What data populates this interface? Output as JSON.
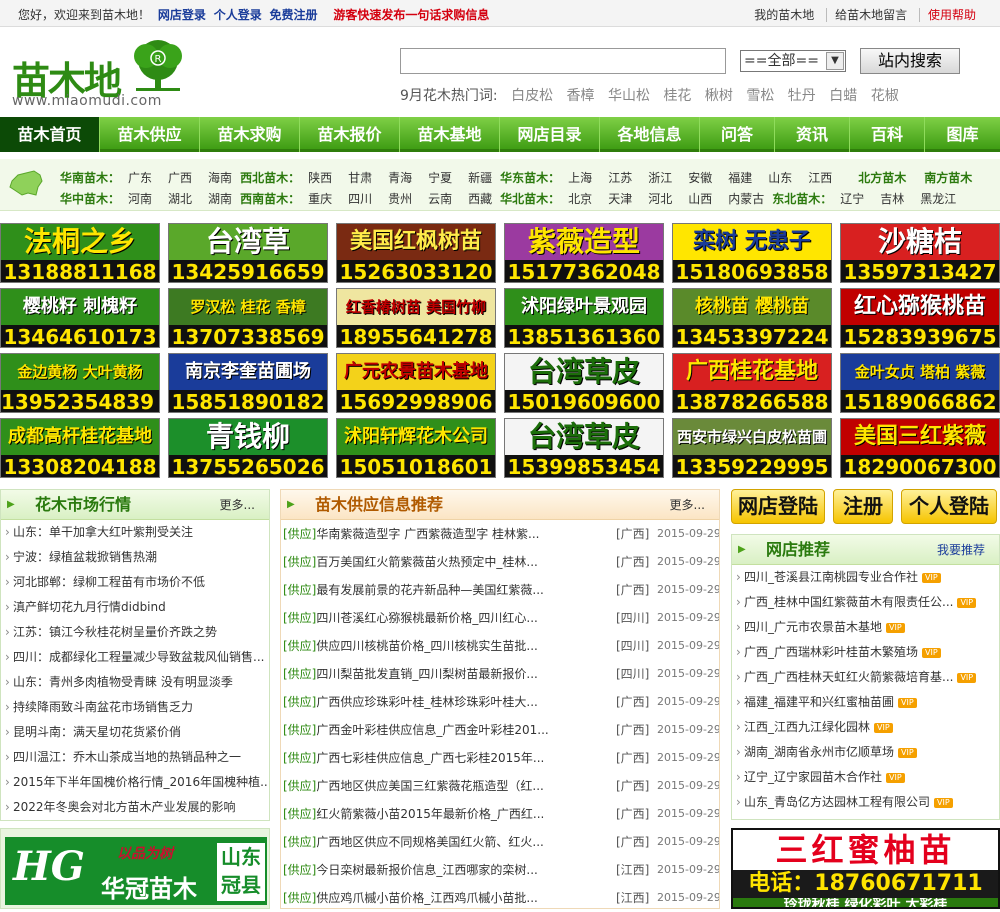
{
  "topbar": {
    "welcome": "您好，欢迎来到苗木地！",
    "shop_login": "网店登录",
    "personal_login": "个人登录",
    "register": "免费注册",
    "guest_post": "游客快速发布一句话求购信息",
    "my_account": "我的苗木地",
    "message": "给苗木地留言",
    "help": "使用帮助"
  },
  "logo": {
    "name": "苗木地",
    "url": "www.miaomudi.com"
  },
  "search": {
    "button": "站内搜索",
    "select": "==全部=="
  },
  "hot": {
    "label": "9月花木热门词:",
    "words": [
      "白皮松",
      "香樟",
      "华山松",
      "桂花",
      "楸树",
      "雪松",
      "牡丹",
      "白蜡",
      "花椒"
    ]
  },
  "nav": [
    "苗木首页",
    "苗木供应",
    "苗木求购",
    "苗木报价",
    "苗木基地",
    "网店目录",
    "各地信息",
    "问答",
    "资讯",
    "百科",
    "图库"
  ],
  "regions": {
    "row1": [
      {
        "name": "华南苗木：",
        "places": [
          "广东",
          "广西",
          "海南"
        ]
      },
      {
        "name": "西北苗木：",
        "places": [
          "陕西",
          "甘肃",
          "青海",
          "宁夏",
          "新疆"
        ]
      },
      {
        "name": "华东苗木：",
        "places": [
          "上海",
          "江苏",
          "浙江",
          "安徽",
          "福建",
          "山东",
          "江西"
        ]
      },
      {
        "name": "北方苗木",
        "places": []
      },
      {
        "name": "南方苗木",
        "places": []
      }
    ],
    "row2": [
      {
        "name": "华中苗木：",
        "places": [
          "河南",
          "湖北",
          "湖南"
        ]
      },
      {
        "name": "西南苗木：",
        "places": [
          "重庆",
          "四川",
          "贵州",
          "云南",
          "西藏"
        ]
      },
      {
        "name": "华北苗木：",
        "places": [
          "北京",
          "天津",
          "河北",
          "山西",
          "内蒙古"
        ]
      },
      {
        "name": "东北苗木：",
        "places": [
          "辽宁",
          "吉林",
          "黑龙江"
        ]
      }
    ]
  },
  "ads": [
    {
      "t1": "法桐之乡",
      "t2": "13188811168",
      "bg": "#2f8f1a",
      "fg": "#ffe600"
    },
    {
      "t1": "台湾草",
      "t2": "13425916659",
      "bg": "#5aa82a",
      "fg": "#ffffff"
    },
    {
      "t1": "美国红枫树苗",
      "t2": "15263033120",
      "bg": "#7a2a12",
      "fg": "#ffec4a"
    },
    {
      "t1": "紫薇造型",
      "t2": "15177362048",
      "bg": "#9b3aa0",
      "fg": "#ffe600"
    },
    {
      "t1": "栾树 无患子",
      "t2": "15180693858",
      "bg": "#ffe600",
      "fg": "#1a3c9a"
    },
    {
      "t1": "沙糖桔",
      "t2": "13597313427",
      "bg": "#d82020",
      "fg": "#ffffff"
    },
    {
      "t1": "樱桃籽 刺槐籽",
      "t2": "13464610173",
      "bg": "#2f8f1a",
      "fg": "#ffffff"
    },
    {
      "t1": "罗汉松 桂花 香樟",
      "t2": "13707338569",
      "bg": "#3d7a22",
      "fg": "#ffe600"
    },
    {
      "t1": "红香椿树苗 美国竹柳",
      "t2": "18955641278",
      "bg": "#efe6a0",
      "fg": "#c00000"
    },
    {
      "t1": "沭阳绿叶景观园",
      "t2": "13851361360",
      "bg": "#2f8f1a",
      "fg": "#ffffff"
    },
    {
      "t1": "核桃苗 樱桃苗",
      "t2": "13453397224",
      "bg": "#5a8a2a",
      "fg": "#ffe600"
    },
    {
      "t1": "红心猕猴桃苗",
      "t2": "15283939675",
      "bg": "#c00000",
      "fg": "#ffffff"
    },
    {
      "t1": "金边黄杨 大叶黄杨",
      "t2": "13952354839 朱",
      "bg": "#2f8f1a",
      "fg": "#ffe600"
    },
    {
      "t1": "南京李奎苗圃场",
      "t2": "15851890182",
      "bg": "#1a3c9a",
      "fg": "#ffffff"
    },
    {
      "t1": "广元农景苗木基地",
      "t2": "15692998906",
      "bg": "#f3d21a",
      "fg": "#c00000"
    },
    {
      "t1": "台湾草皮",
      "t2": "15019609600",
      "bg": "#f4f4f4",
      "fg": "#1c6e0a"
    },
    {
      "t1": "广西桂花基地",
      "t2": "13878266588",
      "bg": "#d82020",
      "fg": "#ffe600"
    },
    {
      "t1": "金叶女贞 塔柏 紫薇",
      "t2": "15189066862",
      "bg": "#1a3c9a",
      "fg": "#ffe600"
    },
    {
      "t1": "成都高杆桂花基地",
      "t2": "13308204188",
      "bg": "#2f8f1a",
      "fg": "#ffe600"
    },
    {
      "t1": "青钱柳",
      "t2": "13755265026",
      "bg": "#1c8f2a",
      "fg": "#ffffff"
    },
    {
      "t1": "沭阳轩辉花木公司",
      "t2": "15051018601",
      "bg": "#2f8f1a",
      "fg": "#ffe600"
    },
    {
      "t1": "台湾草皮",
      "t2": "15399853454",
      "bg": "#f4f4f4",
      "fg": "#1c6e0a"
    },
    {
      "t1": "西安市绿兴白皮松苗圃",
      "t2": "13359229995",
      "bg": "#6a8a3a",
      "fg": "#ffffff"
    },
    {
      "t1": "美国三红紫薇",
      "t2": "18290067300",
      "bg": "#c00000",
      "fg": "#ffe600"
    }
  ],
  "market": {
    "title": "花木市场行情",
    "more": "更多...",
    "items": [
      "山东：单干加拿大红叶紫荆受关注",
      "宁波：绿植盆栽掀销售热潮",
      "河北邯郸：绿柳工程苗有市场价不低",
      "滇产鲜切花九月行情didbind",
      "江苏：镇江今秋桂花树呈量价齐跌之势",
      "四川：成都绿化工程量减少导致盆栽风仙销售...",
      "山东：青州多肉植物受青睐 没有明显淡季",
      "持续降雨致斗南盆花市场销售乏力",
      "昆明斗南：满天星切花货紧价俏",
      "四川温江：乔木山茶成当地的热销品种之一",
      "2015年下半年国槐价格行情_2016年国槐种植...",
      "2022年冬奥会对北方苗木产业发展的影响"
    ]
  },
  "supply": {
    "title": "苗木供应信息推荐",
    "more": "更多...",
    "tag": "[供应]",
    "items": [
      {
        "t": "华南紫薇造型字 广西紫薇造型字 桂林紫...",
        "r": "[广西]",
        "d": "2015-09-29"
      },
      {
        "t": "百万美国红火箭紫薇苗火热预定中_桂林...",
        "r": "[广西]",
        "d": "2015-09-29"
      },
      {
        "t": "最有发展前景的花卉新品种—美国红紫薇...",
        "r": "[广西]",
        "d": "2015-09-29"
      },
      {
        "t": "四川苍溪红心猕猴桃最新价格_四川红心...",
        "r": "[四川]",
        "d": "2015-09-29"
      },
      {
        "t": "供应四川核桃苗价格_四川核桃实生苗批...",
        "r": "[四川]",
        "d": "2015-09-29"
      },
      {
        "t": "四川梨苗批发直销_四川梨树苗最新报价...",
        "r": "[四川]",
        "d": "2015-09-29"
      },
      {
        "t": "广西供应珍珠彩叶桂_桂林珍珠彩叶桂大...",
        "r": "[广西]",
        "d": "2015-09-29"
      },
      {
        "t": "广西金叶彩桂供应信息_广西金叶彩桂201...",
        "r": "[广西]",
        "d": "2015-09-29"
      },
      {
        "t": "广西七彩桂供应信息_广西七彩桂2015年...",
        "r": "[广西]",
        "d": "2015-09-29"
      },
      {
        "t": "广西地区供应美国三红紫薇花瓶造型（红...",
        "r": "[广西]",
        "d": "2015-09-29"
      },
      {
        "t": "红火箭紫薇小苗2015年最新价格_广西红...",
        "r": "[广西]",
        "d": "2015-09-29"
      },
      {
        "t": "广西地区供应不同规格美国红火箭、红火...",
        "r": "[广西]",
        "d": "2015-09-29"
      },
      {
        "t": "今日栾树最新报价信息_江西哪家的栾树...",
        "r": "[江西]",
        "d": "2015-09-29"
      },
      {
        "t": "供应鸡爪槭小苗价格_江西鸡爪槭小苗批...",
        "r": "[江西]",
        "d": "2015-09-29"
      }
    ]
  },
  "buttons": {
    "shop_login": "网店登陆",
    "register": "注册",
    "personal_login": "个人登陆"
  },
  "shops": {
    "title": "网店推荐",
    "more": "我要推荐",
    "vip": "VIP",
    "items": [
      "四川_苍溪县江南桃园专业合作社",
      "广西_桂林中国红紫薇苗木有限责任公...",
      "四川_广元市农景苗木基地",
      "广西_广西瑞林彩叶桂苗木繁殖场",
      "广西_广西桂林天虹红火箭紫薇培育基...",
      "福建_福建平和兴红蜜柚苗圃",
      "江西_江西九江绿化园林",
      "湖南_湖南省永州市亿顺草场",
      "辽宁_辽宁家园苗木合作社",
      "山东_青岛亿方达园林工程有限公司"
    ]
  },
  "banner": {
    "b1": "三红蜜柚苗",
    "b2": "电话：18760671711",
    "b3": "玲珑秋桂 绿化彩叶 大彩桂"
  },
  "hgad": {
    "logo": "HG",
    "tag": "以品为树",
    "name": "华冠苗木",
    "side": "山东 冠县"
  },
  "colors": {
    "brand_green": "#3f9d14",
    "dark_green": "#0c4a06",
    "red": "#d4000f",
    "link_blue": "#1a3c9a"
  }
}
